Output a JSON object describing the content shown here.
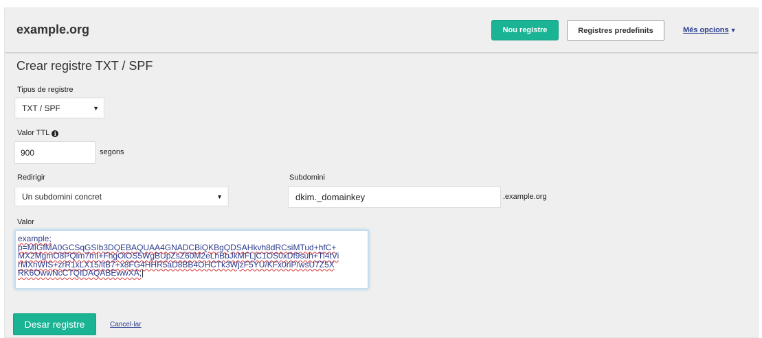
{
  "header": {
    "site_title": "example.org",
    "new_record_button": "Nou registre",
    "predefined_button": "Registres predefinits",
    "more_options_link": "Més opcions",
    "accent_color": "#1ab394"
  },
  "form": {
    "title": "Crear registre TXT / SPF",
    "record_type": {
      "label": "Tipus de registre",
      "value": "TXT / SPF"
    },
    "ttl": {
      "label": "Valor TTL",
      "value": "900",
      "unit": "segons",
      "info_icon": "info-circle-icon"
    },
    "redirect": {
      "label": "Redirigir",
      "value": "Un subdomini concret"
    },
    "subdomain": {
      "label": "Subdomini",
      "value": "dkim._domainkey",
      "suffix": ".example.org"
    },
    "value": {
      "label": "Valor",
      "lines": [
        "example;",
        "p=MIGfMA0GCSqGSIb3DQEBAQUAA4GNADCBiQKBgQDSAHkvh8dRCsiMTud+hfC+",
        "MX2MgmO8PQim7mI+FhgOiOS5WgBUpZsZ60M2eLhBbJkMFLjC1OS0xDf9suh+Tl4tVi",
        "rMXnWIS+zrR1xLX15/ltB7+x8FG4HHR5aD8BB4OHCTk3WjzF5YU/KFx0riP/wsU7Z5X",
        "RK6OwwNcCTQIDAQABEwwXA;"
      ]
    },
    "save_button": "Desar registre",
    "cancel_link": "Cancel·lar"
  }
}
